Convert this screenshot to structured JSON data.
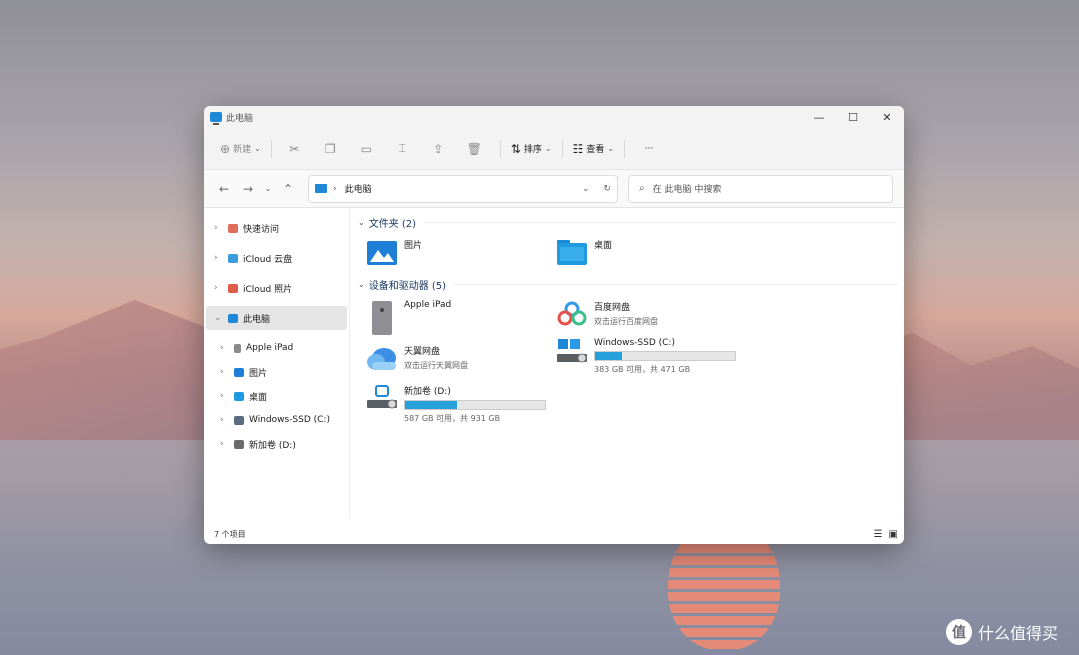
{
  "window": {
    "title": "此电脑"
  },
  "controls": {
    "minimize": "—",
    "maximize": "☐",
    "close": "✕"
  },
  "commandbar": {
    "new": "新建",
    "sort": "排序",
    "view": "查看",
    "more": "···"
  },
  "addressbar": {
    "location": "此电脑",
    "separator": "›"
  },
  "search": {
    "placeholder": "在 此电脑 中搜索"
  },
  "navpane": {
    "items": [
      {
        "label": "快速访问",
        "color": "#e06c5a"
      },
      {
        "label": "iCloud 云盘",
        "color": "#3b9be0"
      },
      {
        "label": "iCloud 照片",
        "color": "#e05a4a"
      },
      {
        "label": "此电脑",
        "color": "#1e88d6"
      },
      {
        "label": "Apple iPad",
        "color": "#8a8a8a"
      },
      {
        "label": "图片",
        "color": "#1e7fd6"
      },
      {
        "label": "桌面",
        "color": "#1e9be0"
      },
      {
        "label": "Windows-SSD (C:)",
        "color": "#5a6b7d"
      },
      {
        "label": "新加卷 (D:)",
        "color": "#6b6b6b"
      }
    ]
  },
  "groups": {
    "folders": "文件夹 (2)",
    "devices": "设备和驱动器 (5)"
  },
  "folders": [
    {
      "name": "图片"
    },
    {
      "name": "桌面"
    }
  ],
  "devices": {
    "ipad": {
      "name": "Apple iPad"
    },
    "baidu": {
      "name": "百度网盘",
      "sub": "双击运行百度网盘"
    },
    "tianyi": {
      "name": "天翼网盘",
      "sub": "双击运行天翼网盘"
    },
    "c_drive": {
      "name": "Windows-SSD (C:)",
      "sub": "383 GB 可用，共 471 GB",
      "used_fraction": 0.19
    },
    "d_drive": {
      "name": "新加卷 (D:)",
      "sub": "587 GB 可用，共 931 GB",
      "used_fraction": 0.37
    }
  },
  "status": {
    "count": "7 个项目"
  },
  "watermark": {
    "text": "什么值得买",
    "logo": "值"
  }
}
